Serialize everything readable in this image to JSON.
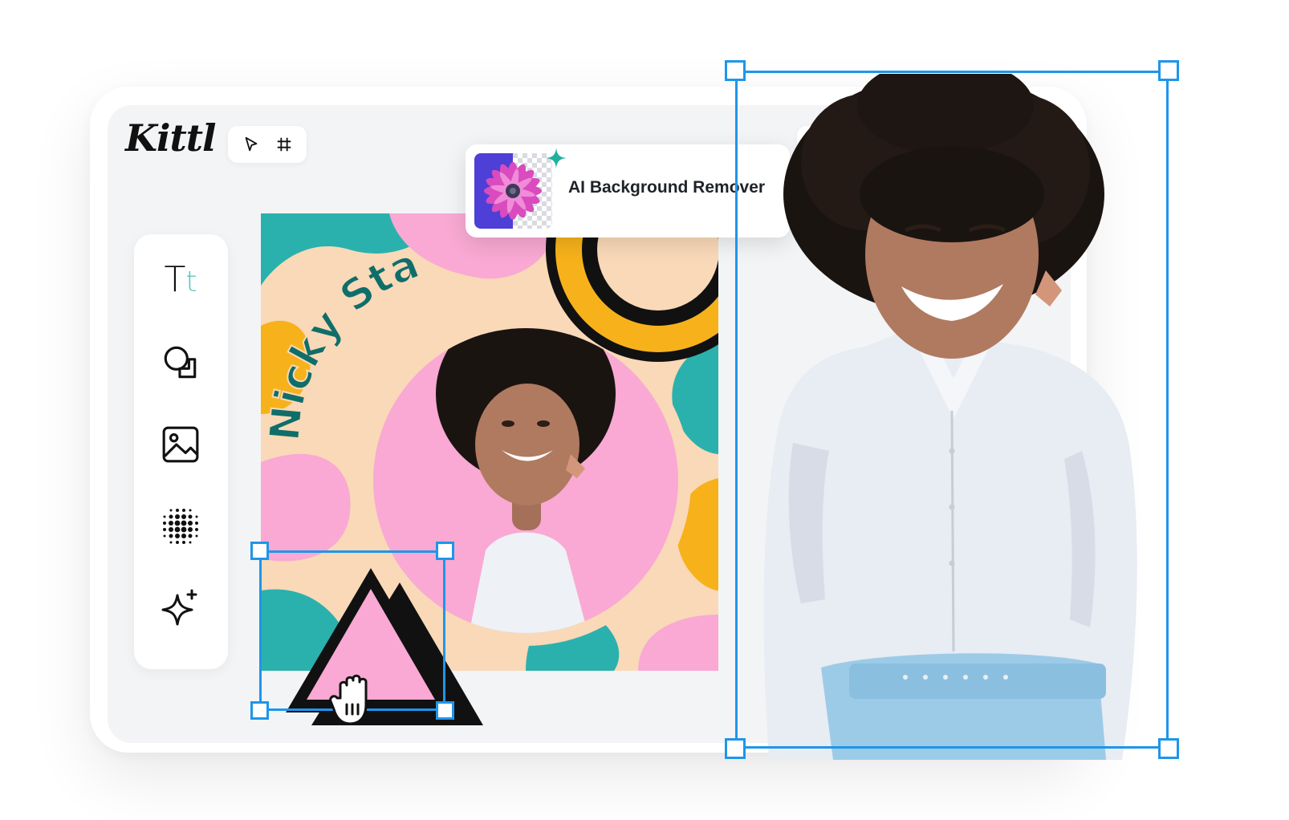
{
  "app": {
    "logo_text": "Kittl"
  },
  "toolbar": {
    "tools": [
      {
        "icon": "cursor-arrow-icon",
        "label": ""
      },
      {
        "icon": "frame-hash-icon",
        "label": ""
      }
    ],
    "right_icon": "truck-icon"
  },
  "sidebar": {
    "items": [
      {
        "icon": "text-tool-icon",
        "glyph_main": "T",
        "glyph_accent": "t"
      },
      {
        "icon": "shapes-icon"
      },
      {
        "icon": "image-icon"
      },
      {
        "icon": "halftone-icon"
      },
      {
        "icon": "ai-sparkle-icon"
      }
    ]
  },
  "canvas": {
    "name_text": "Nicky Stan"
  },
  "feature_card": {
    "label": "AI Background Remover"
  },
  "colors": {
    "selection": "#1e96ea",
    "teal": "#2bb1ad",
    "pink": "#f9a9d3",
    "peach": "#f9d9b7",
    "yellow": "#f7b21b",
    "dark_teal": "#0f6e6a",
    "text_accent": "#5ec6c0"
  }
}
